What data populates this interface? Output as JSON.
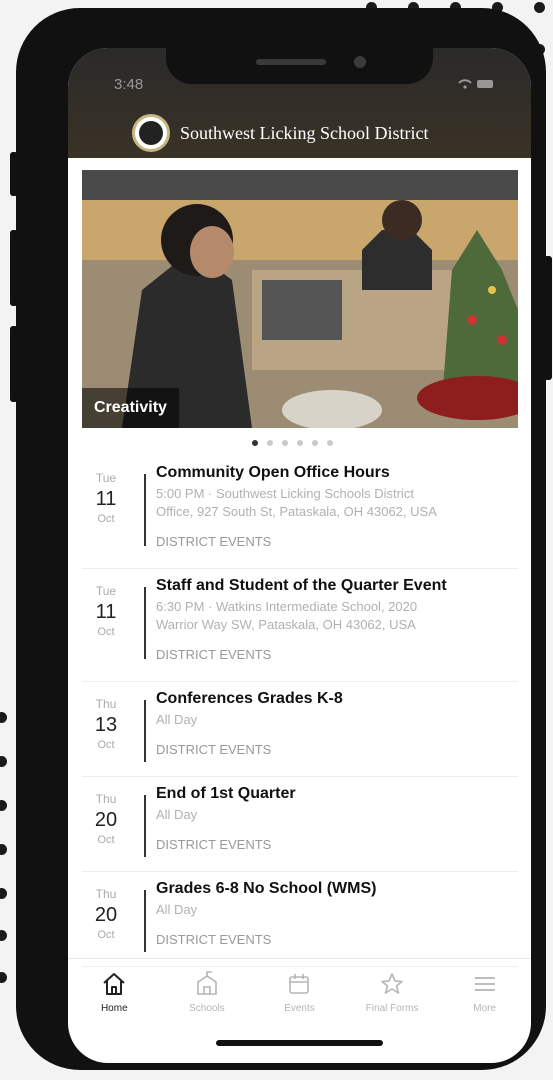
{
  "status_bar": {
    "time": "3:48",
    "icons": "wifi battery"
  },
  "header": {
    "title": "Southwest Licking School District",
    "logo": "district-seal-icon"
  },
  "carousel": {
    "caption": "Creativity",
    "page_count": 6,
    "active_index": 0
  },
  "events": [
    {
      "dow": "Tue",
      "day": "11",
      "month": "Oct",
      "title": "Community Open Office Hours",
      "subtitle_line1": "5:00 PM · Southwest Licking Schools District",
      "subtitle_line2": "Office, 927 South St, Pataskala, OH 43062, USA",
      "category": "DISTRICT EVENTS"
    },
    {
      "dow": "Tue",
      "day": "11",
      "month": "Oct",
      "title": "Staff and Student of the Quarter Event",
      "subtitle_line1": "6:30 PM · Watkins Intermediate School, 2020",
      "subtitle_line2": "Warrior Way SW, Pataskala, OH 43062, USA",
      "category": "DISTRICT EVENTS"
    },
    {
      "dow": "Thu",
      "day": "13",
      "month": "Oct",
      "title": "Conferences Grades K-8",
      "subtitle_line1": "All Day",
      "subtitle_line2": "",
      "category": "DISTRICT EVENTS"
    },
    {
      "dow": "Thu",
      "day": "20",
      "month": "Oct",
      "title": "End of 1st Quarter",
      "subtitle_line1": "All Day",
      "subtitle_line2": "",
      "category": "DISTRICT EVENTS"
    },
    {
      "dow": "Thu",
      "day": "20",
      "month": "Oct",
      "title": "Grades 6-8 No School (WMS)",
      "subtitle_line1": "All Day",
      "subtitle_line2": "",
      "category": "DISTRICT EVENTS"
    }
  ],
  "tabbar": {
    "items": [
      {
        "label": "Home",
        "icon": "home-icon",
        "active": true
      },
      {
        "label": "Schools",
        "icon": "schools-icon",
        "active": false
      },
      {
        "label": "Events",
        "icon": "calendar-icon",
        "active": false
      },
      {
        "label": "Final Forms",
        "icon": "star-icon",
        "active": false
      },
      {
        "label": "More",
        "icon": "menu-icon",
        "active": false
      }
    ]
  }
}
